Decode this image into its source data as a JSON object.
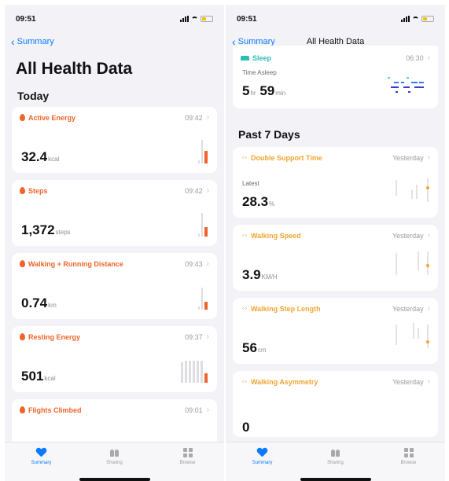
{
  "left": {
    "status_time": "09:51",
    "back_label": "Summary",
    "page_title": "All Health Data",
    "section": "Today",
    "cards": [
      {
        "title": "Active Energy",
        "time": "09:42",
        "value": "32.4",
        "unit": "kcal",
        "icon": "flame-icon"
      },
      {
        "title": "Steps",
        "time": "09:42",
        "value": "1,372",
        "unit": "steps",
        "icon": "flame-icon"
      },
      {
        "title": "Walking + Running Distance",
        "time": "09:43",
        "value": "0.74",
        "unit": "km",
        "icon": "flame-icon"
      },
      {
        "title": "Resting Energy",
        "time": "09:37",
        "value": "501",
        "unit": "kcal",
        "icon": "flame-icon"
      },
      {
        "title": "Flights Climbed",
        "time": "09:01",
        "value": "",
        "unit": "",
        "icon": "flame-icon"
      }
    ]
  },
  "right": {
    "status_time": "09:51",
    "back_label": "Summary",
    "nav_title": "All Health Data",
    "sleep": {
      "title": "Sleep",
      "time": "06:30",
      "label": "Time Asleep",
      "hours": "5",
      "hr_unit": "hr",
      "minutes": "59",
      "min_unit": "min"
    },
    "section": "Past 7 Days",
    "cards": [
      {
        "title": "Double Support Time",
        "time": "Yesterday",
        "sub": "Latest",
        "value": "28.3",
        "unit": "%"
      },
      {
        "title": "Walking Speed",
        "time": "Yesterday",
        "sub": "",
        "value": "3.9",
        "unit": "KM/H"
      },
      {
        "title": "Walking Step Length",
        "time": "Yesterday",
        "sub": "",
        "value": "56",
        "unit": "cm"
      },
      {
        "title": "Walking Asymmetry",
        "time": "Yesterday",
        "sub": "",
        "value": "0",
        "unit": ""
      }
    ]
  },
  "tabs": [
    {
      "label": "Summary",
      "icon": "heart-icon"
    },
    {
      "label": "Sharing",
      "icon": "people-icon"
    },
    {
      "label": "Browse",
      "icon": "grid-icon"
    }
  ],
  "colors": {
    "accent": "#0a7aff",
    "activity": "#f0642a",
    "mobility": "#f1a532",
    "sleep": "#2bbfb0",
    "background": "#f2f2f7"
  }
}
